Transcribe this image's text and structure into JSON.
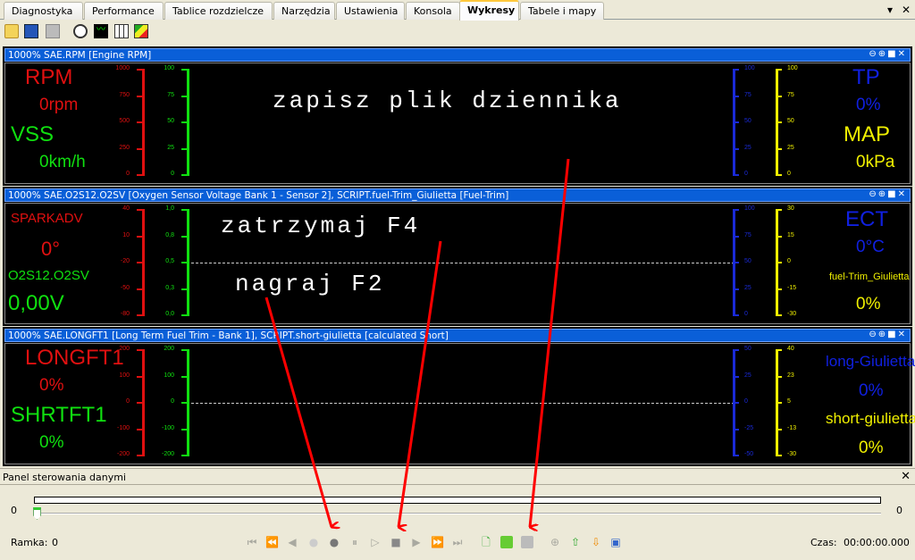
{
  "tabs": [
    "Diagnostyka",
    "Performance",
    "Tablice rozdzielcze",
    "Narzędzia",
    "Ustawienia",
    "Konsola",
    "Wykresy",
    "Tabele i mapy"
  ],
  "active_tab": "Wykresy",
  "toolbar_icons": [
    "open-folder-icon",
    "save-icon",
    "export-icon",
    "gauge-icon",
    "chart-icon",
    "table-icon",
    "map-icon"
  ],
  "panels": [
    {
      "title": "1000% SAE.RPM [Engine RPM]",
      "left": [
        {
          "label": "RPM",
          "value": "0rpm",
          "color": "#e01010"
        },
        {
          "label": "VSS",
          "value": "0km/h",
          "color": "#10e010"
        }
      ],
      "right": [
        {
          "label": "TP",
          "value": "0%",
          "color": "#1020e0"
        },
        {
          "label": "MAP",
          "value": "0kPa",
          "color": "#f0f000"
        }
      ],
      "scales": {
        "red": [
          "1000",
          "750",
          "500",
          "250",
          "0"
        ],
        "green": [
          "100",
          "75",
          "50",
          "25",
          "0"
        ],
        "blue": [
          "100",
          "75",
          "50",
          "25",
          "0"
        ],
        "yellow": [
          "100",
          "75",
          "50",
          "25",
          "0"
        ]
      },
      "dashed": false
    },
    {
      "title": "1000% SAE.O2S12.O2SV [Oxygen Sensor Voltage Bank 1 - Sensor 2], SCRIPT.fuel-Trim_Giulietta [Fuel-Trim]",
      "left": [
        {
          "label": "SPARKADV",
          "value": "0°",
          "color": "#e01010"
        },
        {
          "label": "O2S12.O2SV",
          "value": "0,00V",
          "color": "#10e010"
        }
      ],
      "right": [
        {
          "label": "ECT",
          "value": "0°C",
          "color": "#1020e0"
        },
        {
          "label": "fuel-Trim_Giulietta",
          "value": "0%",
          "color": "#f0f000"
        }
      ],
      "scales": {
        "red": [
          "40",
          "10",
          "-20",
          "-50",
          "-80"
        ],
        "green": [
          "1,0",
          "0,8",
          "0,5",
          "0,3",
          "0,0"
        ],
        "blue": [
          "100",
          "75",
          "50",
          "25",
          "0"
        ],
        "yellow": [
          "30",
          "15",
          "0",
          "-15",
          "-30"
        ]
      },
      "dashed": true
    },
    {
      "title": "1000% SAE.LONGFT1 [Long Term Fuel Trim - Bank 1], SCRIPT.short-giulietta [calculated Short]",
      "left": [
        {
          "label": "LONGFT1",
          "value": "0%",
          "color": "#e01010"
        },
        {
          "label": "SHRTFT1",
          "value": "0%",
          "color": "#10e010"
        }
      ],
      "right": [
        {
          "label": "long-Giulietta",
          "value": "0%",
          "color": "#1020e0"
        },
        {
          "label": "short-giulietta",
          "value": "0%",
          "color": "#f0f000"
        }
      ],
      "scales": {
        "red": [
          "200",
          "100",
          "0",
          "-100",
          "-200"
        ],
        "green": [
          "200",
          "100",
          "0",
          "-100",
          "-200"
        ],
        "blue": [
          "50",
          "25",
          "0",
          "-25",
          "-50"
        ],
        "yellow": [
          "40",
          "23",
          "5",
          "-13",
          "-30"
        ]
      },
      "dashed": true
    }
  ],
  "annotations": [
    "zapisz plik dziennika",
    "zatrzymaj F4",
    "nagraj F2"
  ],
  "control": {
    "title": "Panel sterowania danymi",
    "slider_min": "0",
    "slider_max": "0",
    "slider_value": 0,
    "frame_label": "Ramka:",
    "frame_value": "0",
    "time_label": "Czas:",
    "time_value": "00:00:00.000"
  }
}
